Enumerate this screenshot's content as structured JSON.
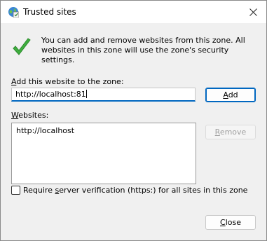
{
  "window": {
    "title": "Trusted sites"
  },
  "info": {
    "text": "You can add and remove websites from this zone. All websites in this zone will use the zone's security settings."
  },
  "add_site": {
    "label_accel": "A",
    "label_rest": "dd this website to the zone:",
    "input_value": "http://localhost:81",
    "button_accel": "A",
    "button_rest": "dd"
  },
  "websites": {
    "label_accel": "W",
    "label_rest": "ebsites:",
    "items": [
      "http://localhost"
    ],
    "remove_accel": "R",
    "remove_rest": "emove"
  },
  "verification": {
    "label_before": "Require ",
    "label_accel": "s",
    "label_after": "erver verification (https:) for all sites in this zone",
    "checked": false
  },
  "footer": {
    "close_accel": "C",
    "close_rest": "lose"
  }
}
